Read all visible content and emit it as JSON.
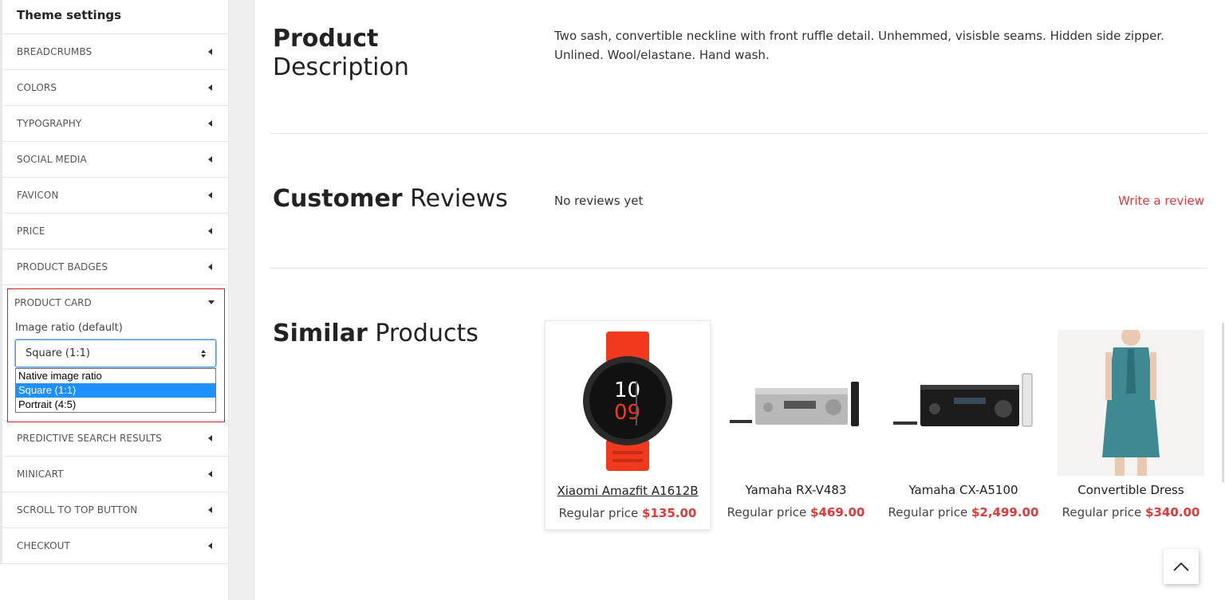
{
  "sidebar": {
    "title": "Theme settings",
    "items_top": [
      {
        "label": "BREADCRUMBS"
      },
      {
        "label": "COLORS"
      },
      {
        "label": "TYPOGRAPHY"
      },
      {
        "label": "SOCIAL MEDIA"
      },
      {
        "label": "FAVICON"
      },
      {
        "label": "PRICE"
      },
      {
        "label": "PRODUCT BADGES"
      }
    ],
    "product_card": {
      "label": "PRODUCT CARD",
      "field_label": "Image ratio (default)",
      "selected": "Square (1:1)",
      "options": [
        "Native image ratio",
        "Square (1:1)",
        "Portrait (4:5)"
      ]
    },
    "items_bottom": [
      {
        "label": "PREDICTIVE SEARCH RESULTS"
      },
      {
        "label": "MINICART"
      },
      {
        "label": "SCROLL TO TOP BUTTON"
      },
      {
        "label": "CHECKOUT"
      }
    ]
  },
  "main": {
    "description": {
      "title_bold": "Product",
      "title_light": "Description",
      "text": "Two sash, convertible neckline with front ruffle detail. Unhemmed, visisble seams. Hidden side zipper. Unlined. Wool/elastane. Hand wash."
    },
    "reviews": {
      "title_bold": "Customer",
      "title_light": "Reviews",
      "empty_text": "No reviews yet",
      "write_link": "Write a review"
    },
    "similar": {
      "title_bold": "Similar",
      "title_light": "Products",
      "products": [
        {
          "name": "Xiaomi Amazfit A1612B",
          "price_label": "Regular price",
          "price": "$135.00",
          "icon": "smartwatch-image"
        },
        {
          "name": "Yamaha RX-V483",
          "price_label": "Regular price",
          "price": "$469.00",
          "icon": "av-receiver-image"
        },
        {
          "name": "Yamaha CX-A5100",
          "price_label": "Regular price",
          "price": "$2,499.00",
          "icon": "av-preamp-image"
        },
        {
          "name": "Convertible Dress",
          "price_label": "Regular price",
          "price": "$340.00",
          "icon": "dress-image"
        }
      ]
    }
  },
  "colors": {
    "accent_red": "#e03a3a",
    "highlight_box": "#d81f26",
    "select_focus": "#5b9ad6",
    "option_selected_bg": "#1e90ff"
  }
}
